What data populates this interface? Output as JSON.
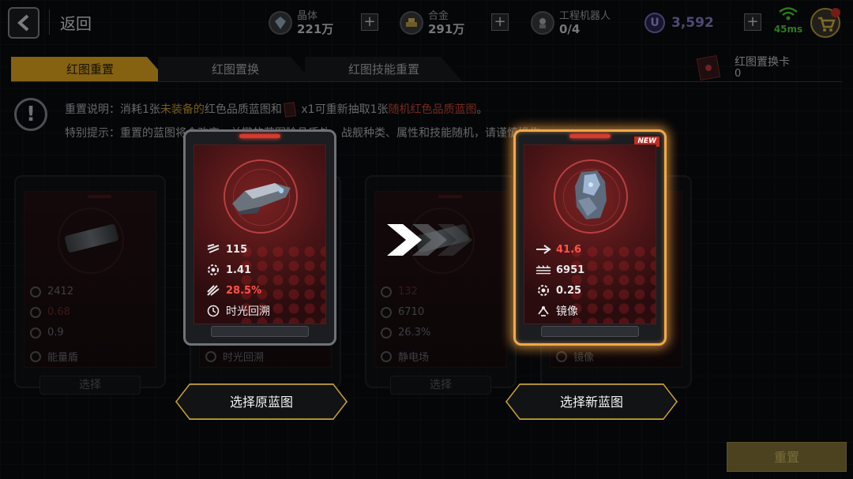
{
  "header": {
    "back_label": "返回",
    "resources": [
      {
        "name": "晶体",
        "value": "221万",
        "icon": "crystal-icon"
      },
      {
        "name": "合金",
        "value": "291万",
        "icon": "alloy-icon"
      },
      {
        "name": "工程机器人",
        "value": "0/4",
        "icon": "robot-icon"
      }
    ],
    "currency": {
      "symbol": "U",
      "value": "3,592"
    },
    "ping": "45ms"
  },
  "tabs": [
    {
      "label": "红图重置",
      "active": true
    },
    {
      "label": "红图置换",
      "active": false
    },
    {
      "label": "红图技能重置",
      "active": false
    }
  ],
  "swap_card": {
    "name": "红图置换卡",
    "count": "0"
  },
  "notice": {
    "line1_prefix": "重置说明：消耗1张",
    "line1_hl1": "未装备的",
    "line1_mid": "红色品质蓝图和",
    "line1_x": " x1可重新抽取1张",
    "line1_hl2": "随机红色品质蓝图",
    "line1_end": "。",
    "line2": "特别提示：重置的蓝图将会改变，关键的蓝图除品质外，战舰种类、属性和技能随机，请谨慎操作"
  },
  "background_cards": [
    {
      "stats": [
        "2412",
        "0.68",
        "0.9"
      ],
      "skill": "能量盾",
      "select": "选择"
    },
    {
      "stats": [],
      "skill": "时光回溯",
      "select": ""
    },
    {
      "stats": [
        "132",
        "6710",
        "26.3%"
      ],
      "skill": "静电场",
      "select": "选择"
    },
    {
      "stats": [],
      "skill": "镜像",
      "select": ""
    }
  ],
  "original_card": {
    "stats": [
      {
        "icon": "fire-rate-icon",
        "value": "115"
      },
      {
        "icon": "gear-icon",
        "value": "1.41"
      },
      {
        "icon": "missile-icon",
        "value": "28.5%",
        "highlight": true
      }
    ],
    "skill": "时光回溯"
  },
  "new_card": {
    "badge": "NEW",
    "stats": [
      {
        "icon": "arrow-icon",
        "value": "41.6",
        "highlight": true
      },
      {
        "icon": "hull-icon",
        "value": "6951"
      },
      {
        "icon": "gear-icon",
        "value": "0.25"
      }
    ],
    "skill": "镜像"
  },
  "buttons": {
    "select_original": "选择原蓝图",
    "select_new": "选择新蓝图",
    "reset": "重置"
  },
  "colors": {
    "accent": "#f0b322",
    "highlight_red": "#ff5346",
    "highlight_yellow": "#d8a72c",
    "glow": "#f0a84a"
  }
}
